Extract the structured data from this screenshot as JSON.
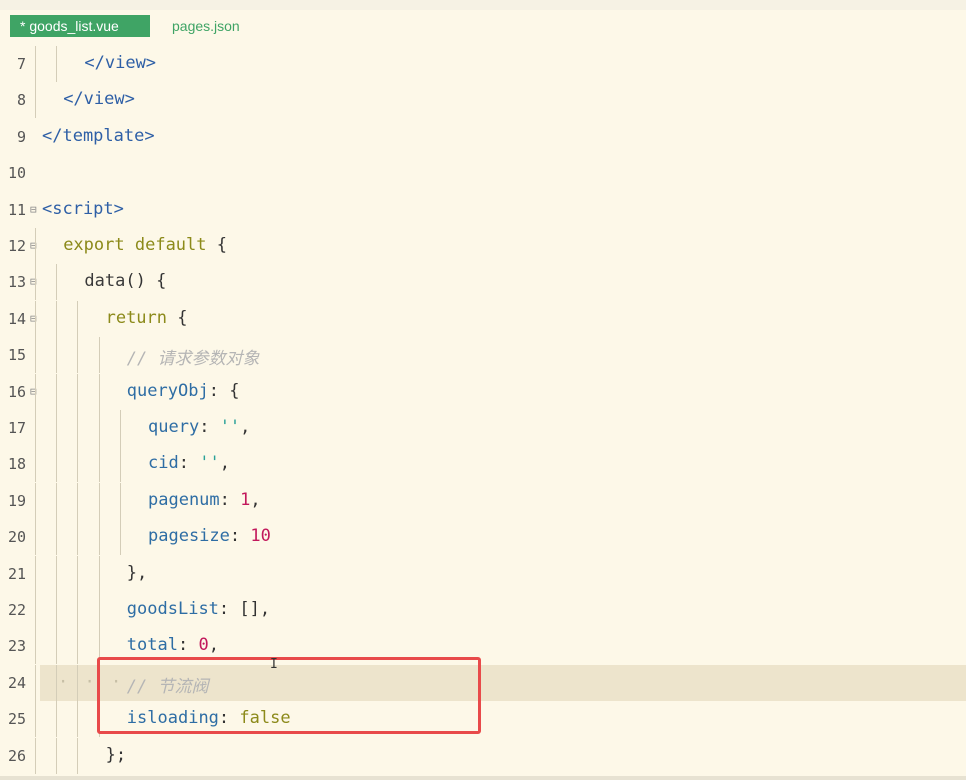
{
  "tabs": [
    {
      "label": "* goods_list.vue",
      "active": true
    },
    {
      "label": "pages.json",
      "active": false
    }
  ],
  "editor": {
    "highlight_color": "#e84a4a",
    "lines": [
      {
        "num": "7",
        "fold": false,
        "indent": 2,
        "code": "</view>"
      },
      {
        "num": "8",
        "fold": false,
        "indent": 1,
        "code": "</view>"
      },
      {
        "num": "9",
        "fold": false,
        "indent": 0,
        "code": "</template>"
      },
      {
        "num": "10",
        "fold": false,
        "indent": 0,
        "code": ""
      },
      {
        "num": "11",
        "fold": true,
        "indent": 0,
        "code": "<script>"
      },
      {
        "num": "12",
        "fold": true,
        "indent": 1,
        "code": "export default {"
      },
      {
        "num": "13",
        "fold": true,
        "indent": 2,
        "code": "data() {"
      },
      {
        "num": "14",
        "fold": true,
        "indent": 3,
        "code": "return {"
      },
      {
        "num": "15",
        "fold": false,
        "indent": 4,
        "code": "// 请求参数对象"
      },
      {
        "num": "16",
        "fold": true,
        "indent": 4,
        "code": "queryObj: {"
      },
      {
        "num": "17",
        "fold": false,
        "indent": 5,
        "code": "query: '',"
      },
      {
        "num": "18",
        "fold": false,
        "indent": 5,
        "code": "cid: '',"
      },
      {
        "num": "19",
        "fold": false,
        "indent": 5,
        "code": "pagenum: 1,"
      },
      {
        "num": "20",
        "fold": false,
        "indent": 5,
        "code": "pagesize: 10"
      },
      {
        "num": "21",
        "fold": false,
        "indent": 4,
        "code": "},"
      },
      {
        "num": "22",
        "fold": false,
        "indent": 4,
        "code": "goodsList: [],"
      },
      {
        "num": "23",
        "fold": false,
        "indent": 4,
        "code": "total: 0,"
      },
      {
        "num": "24",
        "fold": false,
        "indent": 4,
        "code": "// 节流阀",
        "current": true
      },
      {
        "num": "25",
        "fold": false,
        "indent": 4,
        "code": "isloading: false"
      },
      {
        "num": "26",
        "fold": false,
        "indent": 3,
        "code": "};"
      }
    ]
  }
}
